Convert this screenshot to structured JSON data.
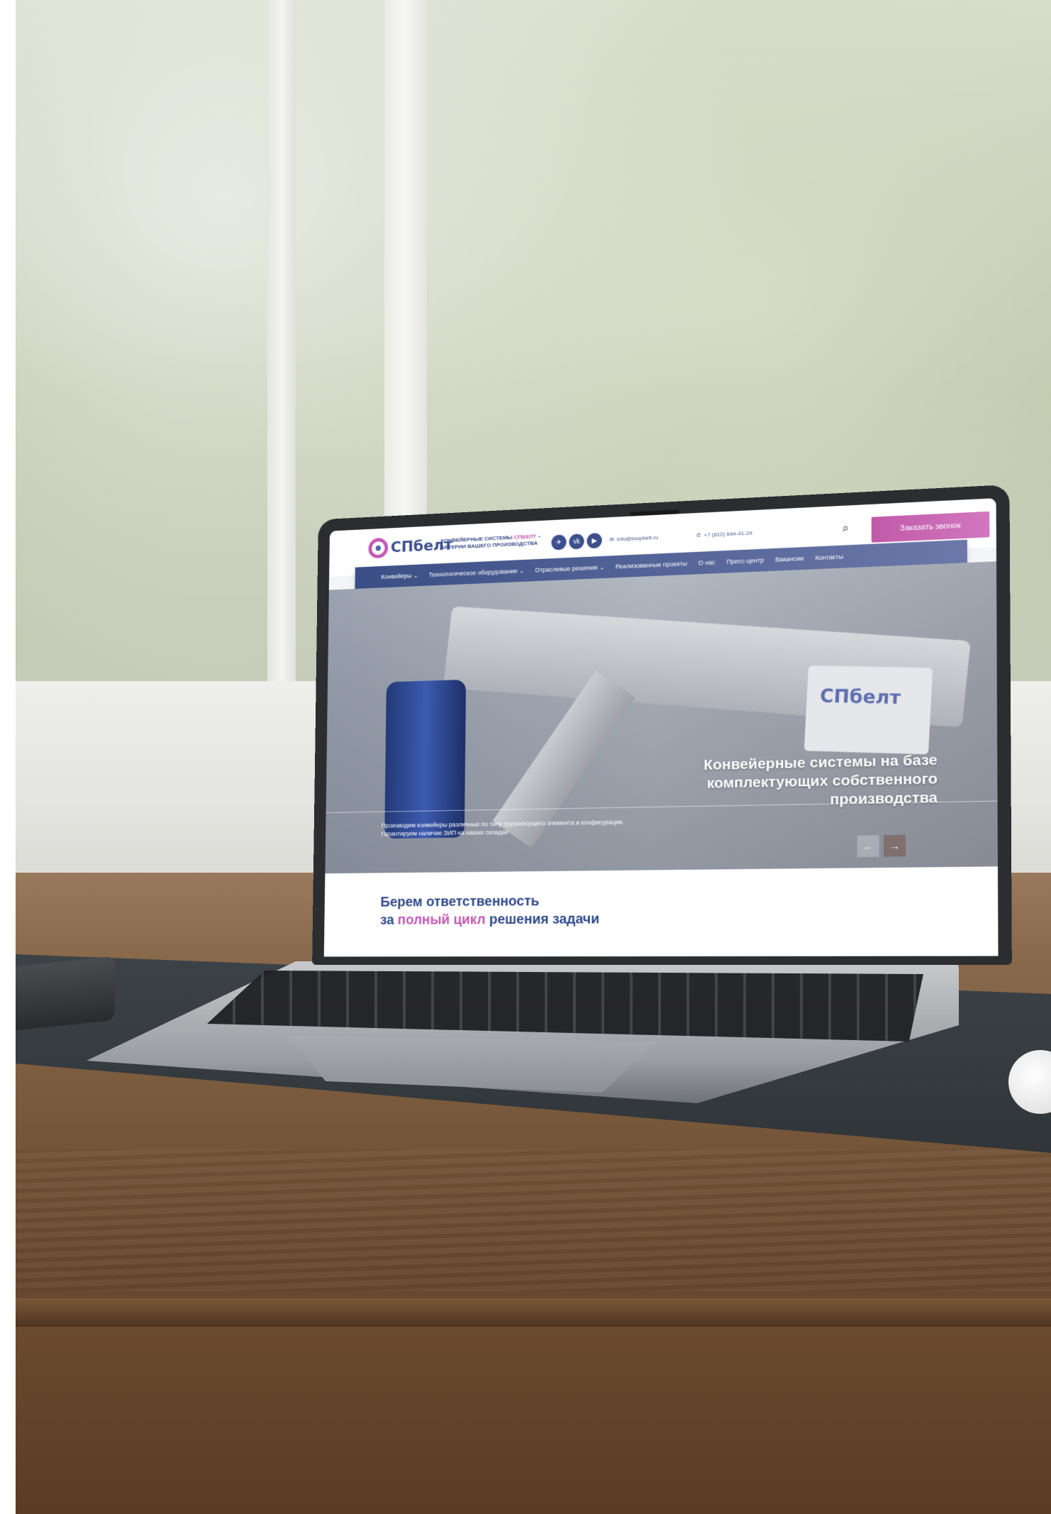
{
  "site": {
    "logo_text": "СПбелт",
    "tagline_prefix": "КОНВЕЙЕРНЫЕ СИСТЕМЫ ",
    "tagline_brand": "СПБЕЛТ",
    "tagline_suffix": " – АРТЕРИИ ВАШЕГО ПРОИЗВОДСТВА",
    "socials": [
      "telegram-icon",
      "vk-icon",
      "video-icon"
    ],
    "email": "info@ksspbelt.ru",
    "phone": "+7 (812) 644-41-24",
    "callback_label": "Заказать звонок",
    "nav": [
      "Конвейеры ⌄",
      "Технологическое оборудование ⌄",
      "Отраслевые решения ⌄",
      "Реализованные проекты",
      "О нас",
      "Пресс-центр",
      "Вакансии",
      "Контакты"
    ],
    "hero": {
      "plate_logo": "СПбелт",
      "title": "Конвейерные системы на базе комплектующих собственного производства",
      "subtitle": "Производим конвейеры различные по типу грузонесущего элемента и конфигурации. Гарантируем наличие ЗИП на наших складах",
      "prev_arrow": "←",
      "next_arrow": "→"
    },
    "section": {
      "line1": "Берем ответственность",
      "line2_prefix": "за ",
      "line2_accent": "полный цикл",
      "line2_suffix": " решения задачи"
    }
  },
  "colors": {
    "brand_blue": "#3c4f8c",
    "brand_pink": "#c458b4",
    "nav_gradient_start": "#3a4f85",
    "nav_gradient_end": "#6c78a9"
  }
}
